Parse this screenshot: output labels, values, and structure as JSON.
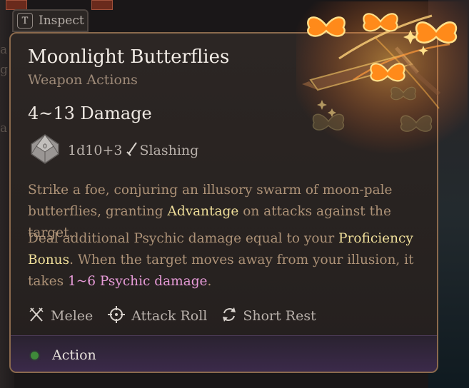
{
  "inspect": {
    "key": "T",
    "label": "Inspect"
  },
  "tooltip": {
    "title": "Moonlight Butterflies",
    "subtitle": "Weapon Actions",
    "damage": "4~13 Damage",
    "dice_formula": "1d10+3",
    "damage_type": "Slashing",
    "description": {
      "part1": "Strike a foe, conjuring an illusory swarm of moon-pale butterflies, granting ",
      "advantage": "Advantage",
      "part2": " on attacks against the target."
    },
    "extra": {
      "part1": "Deal additional Psychic damage equal to your ",
      "proficiency": "Proficiency Bonus",
      "part2": ". When the target moves away from your illusion, it takes ",
      "psychic": "1~6 Psychic damage",
      "part3": "."
    },
    "tags": [
      "Melee",
      "Attack Roll",
      "Short Rest"
    ],
    "action": {
      "label": "Action",
      "color": "#3f8a3a"
    }
  },
  "colors": {
    "accent_gold": "#f0df9a",
    "accent_pink": "#e79bd8",
    "border": "#8b6a4d",
    "body_text": "#ad9277"
  },
  "icons": [
    "d10-dice-icon",
    "sword-icon",
    "crossed-swords-icon",
    "crosshair-icon",
    "rest-cycle-icon",
    "butterfly-art"
  ]
}
